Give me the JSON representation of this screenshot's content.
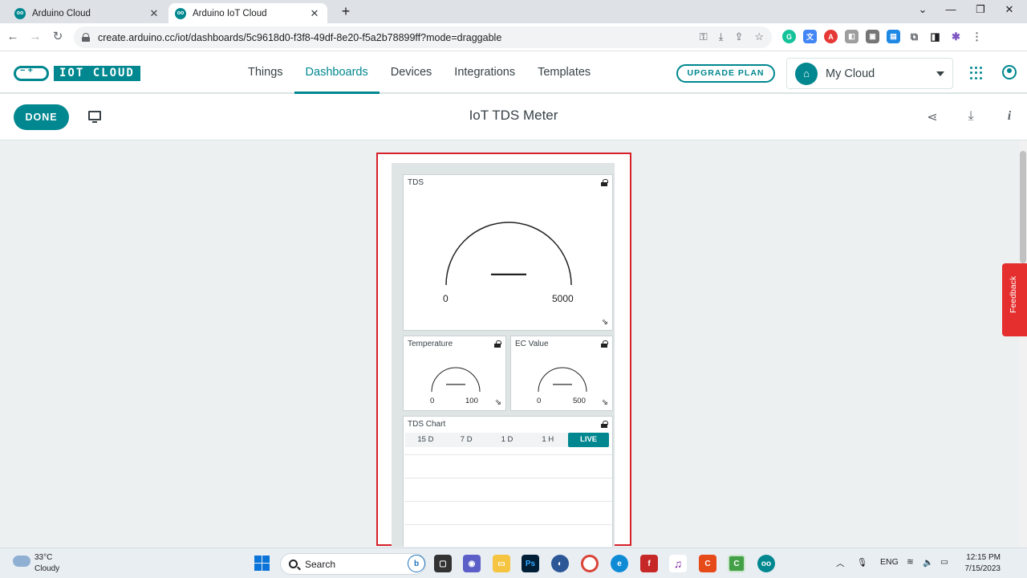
{
  "browser": {
    "tabs": [
      {
        "title": "Arduino Cloud",
        "close": "✕"
      },
      {
        "title": "Arduino IoT Cloud",
        "close": "✕"
      }
    ],
    "new_tab": "+",
    "url": "create.arduino.cc/iot/dashboards/5c9618d0-f3f8-49df-8e20-f5a2b78899ff?mode=draggable"
  },
  "app": {
    "logo_text": "IOT CLOUD",
    "nav": [
      "Things",
      "Dashboards",
      "Devices",
      "Integrations",
      "Templates"
    ],
    "active_nav": "Dashboards",
    "upgrade_label": "UPGRADE PLAN",
    "cloud_selector": "My Cloud",
    "accent_color": "#00878f"
  },
  "dashboard": {
    "done_label": "DONE",
    "title": "IoT TDS Meter"
  },
  "widgets": {
    "tds": {
      "title": "TDS",
      "value": "——",
      "min": "0",
      "max": "5000"
    },
    "temperature": {
      "title": "Temperature",
      "value": "——",
      "min": "0",
      "max": "100"
    },
    "ec": {
      "title": "EC Value",
      "value": "——",
      "min": "0",
      "max": "500"
    },
    "chart": {
      "title": "TDS Chart",
      "ranges": [
        "15 D",
        "7 D",
        "1 D",
        "1 H",
        "LIVE"
      ],
      "active_range": "LIVE"
    }
  },
  "feedback_label": "Feedback",
  "taskbar": {
    "weather_temp": "33°C",
    "weather_desc": "Cloudy",
    "search_label": "Search",
    "language": "ENG",
    "time": "12:15 PM",
    "date": "7/15/2023"
  }
}
